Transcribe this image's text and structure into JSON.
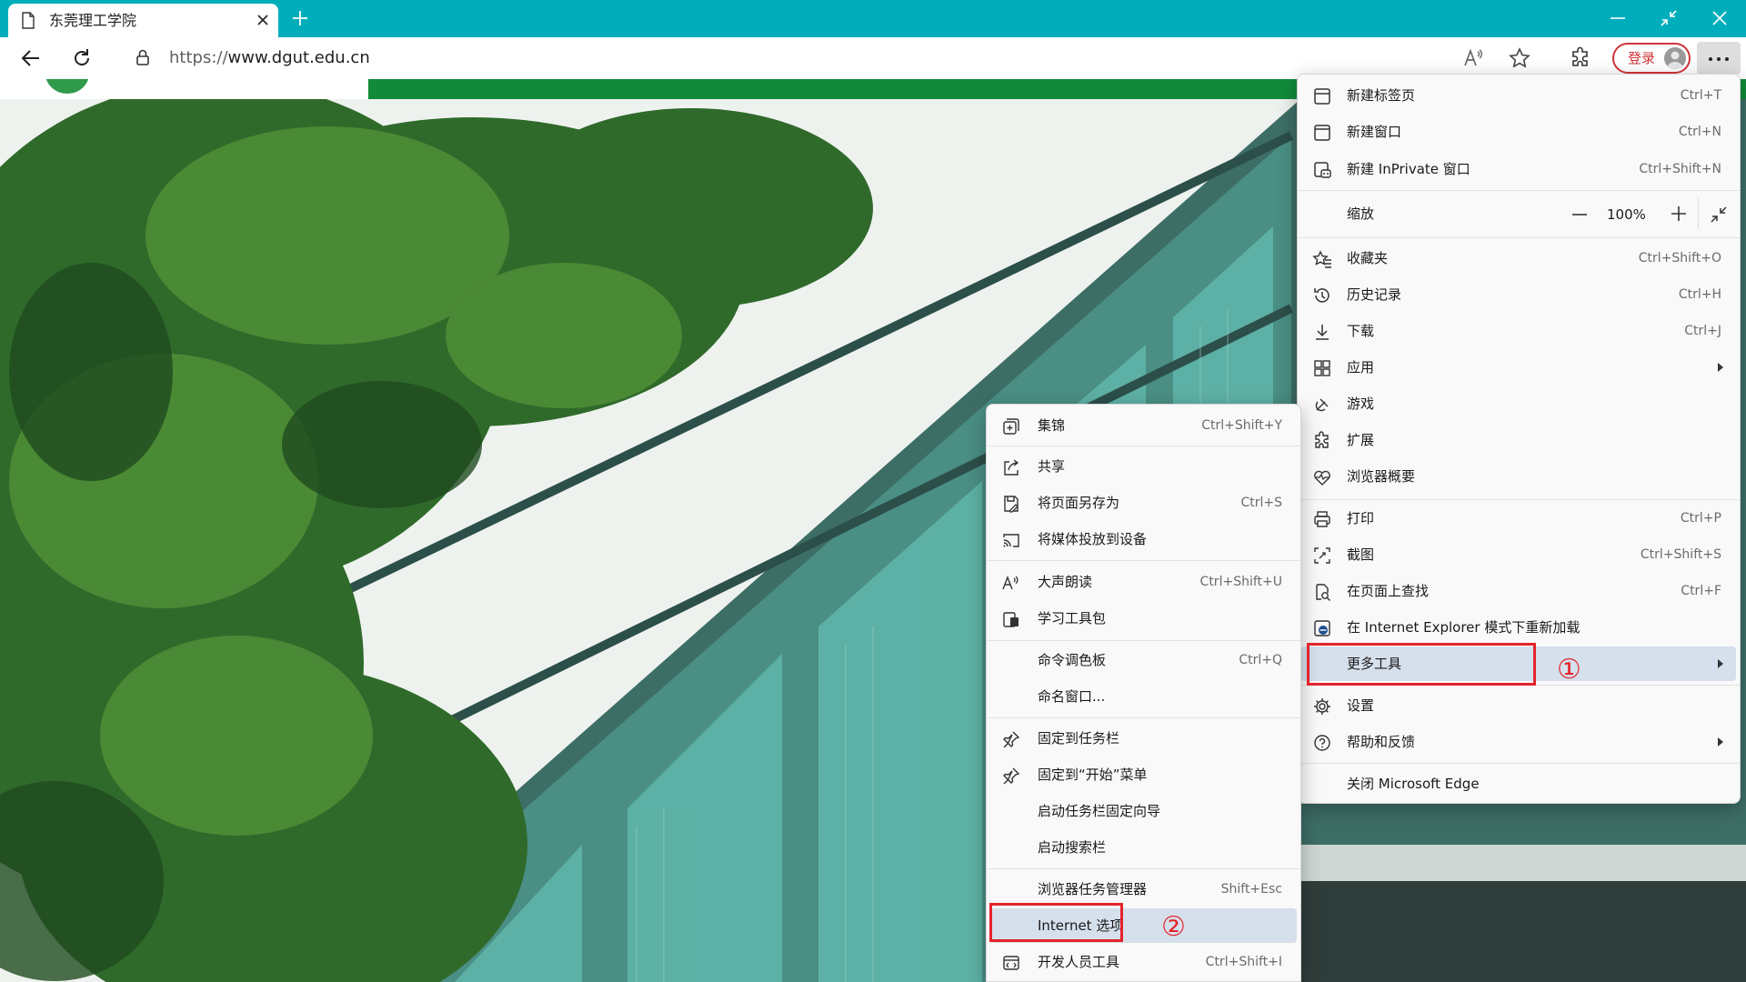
{
  "window": {
    "tab_title": "东莞理工学院",
    "url_protocol": "https://",
    "url_rest": "www.dgut.edu.cn"
  },
  "toolbar": {
    "login_label": "登录"
  },
  "main_menu": {
    "new_tab": {
      "label": "新建标签页",
      "shortcut": "Ctrl+T"
    },
    "new_window": {
      "label": "新建窗口",
      "shortcut": "Ctrl+N"
    },
    "new_inprivate": {
      "label": "新建 InPrivate 窗口",
      "shortcut": "Ctrl+Shift+N"
    },
    "zoom": {
      "label": "缩放",
      "value": "100%"
    },
    "favorites": {
      "label": "收藏夹",
      "shortcut": "Ctrl+Shift+O"
    },
    "history": {
      "label": "历史记录",
      "shortcut": "Ctrl+H"
    },
    "downloads": {
      "label": "下载",
      "shortcut": "Ctrl+J"
    },
    "apps": {
      "label": "应用"
    },
    "games": {
      "label": "游戏"
    },
    "extensions": {
      "label": "扩展"
    },
    "browser_essentials": {
      "label": "浏览器概要"
    },
    "print": {
      "label": "打印",
      "shortcut": "Ctrl+P"
    },
    "screenshot": {
      "label": "截图",
      "shortcut": "Ctrl+Shift+S"
    },
    "find": {
      "label": "在页面上查找",
      "shortcut": "Ctrl+F"
    },
    "ie_mode": {
      "label": "在 Internet Explorer 模式下重新加载"
    },
    "more_tools": {
      "label": "更多工具"
    },
    "settings": {
      "label": "设置"
    },
    "help": {
      "label": "帮助和反馈"
    },
    "close_edge": {
      "label": "关闭 Microsoft Edge"
    }
  },
  "sub_menu": {
    "collections": {
      "label": "集锦",
      "shortcut": "Ctrl+Shift+Y"
    },
    "share": {
      "label": "共享"
    },
    "save_page": {
      "label": "将页面另存为",
      "shortcut": "Ctrl+S"
    },
    "cast": {
      "label": "将媒体投放到设备"
    },
    "read_aloud": {
      "label": "大声朗读",
      "shortcut": "Ctrl+Shift+U"
    },
    "learning_tools": {
      "label": "学习工具包"
    },
    "command_palette": {
      "label": "命令调色板",
      "shortcut": "Ctrl+Q"
    },
    "name_window": {
      "label": "命名窗口..."
    },
    "pin_taskbar": {
      "label": "固定到任务栏"
    },
    "pin_start": {
      "label": "固定到“开始”菜单"
    },
    "taskbar_wizard": {
      "label": "启动任务栏固定向导"
    },
    "search_bar": {
      "label": "启动搜索栏"
    },
    "task_manager": {
      "label": "浏览器任务管理器",
      "shortcut": "Shift+Esc"
    },
    "internet_options": {
      "label": "Internet 选项"
    },
    "dev_tools": {
      "label": "开发人员工具",
      "shortcut": "Ctrl+Shift+I"
    }
  },
  "annotations": {
    "step1": "①",
    "step2": "②"
  },
  "colors": {
    "tabbar": "#00aebb",
    "site_green": "#118a3a",
    "annotation_red": "#e3242b",
    "menu_highlight": "#d6dfec"
  }
}
